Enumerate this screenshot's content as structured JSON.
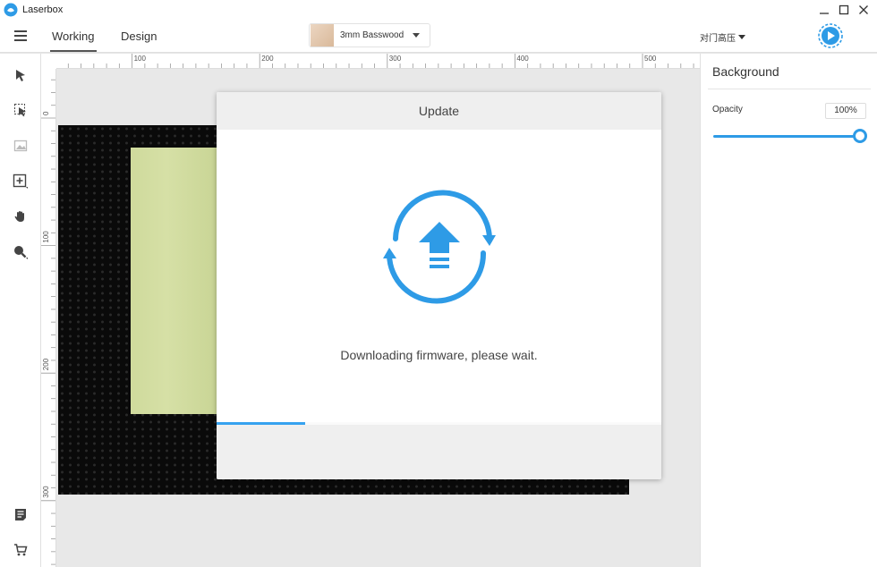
{
  "window": {
    "title": "Laserbox"
  },
  "header": {
    "tabs": [
      {
        "label": "Working",
        "active": true
      },
      {
        "label": "Design",
        "active": false
      }
    ],
    "material": "3mm Basswood",
    "mode": "对门高压"
  },
  "ruler": {
    "top_labels": [
      "100",
      "200",
      "300",
      "400",
      "500"
    ],
    "left_labels": [
      "0",
      "100",
      "200",
      "300"
    ]
  },
  "right_panel": {
    "title": "Background",
    "opacity_label": "Opacity",
    "opacity_value": "100%",
    "opacity_fraction": 1.0
  },
  "modal": {
    "title": "Update",
    "message": "Downloading firmware, please wait.",
    "progress_fraction": 0.2
  },
  "colors": {
    "accent": "#2e9be6",
    "wood": "#d2dca0",
    "bed": "#0a0a0a"
  },
  "icons": {
    "toolbar": [
      "select-arrow-icon",
      "select-area-icon",
      "image-icon",
      "add-shape-icon",
      "hand-pan-icon",
      "zoom-icon",
      "notes-icon",
      "cart-icon"
    ]
  }
}
